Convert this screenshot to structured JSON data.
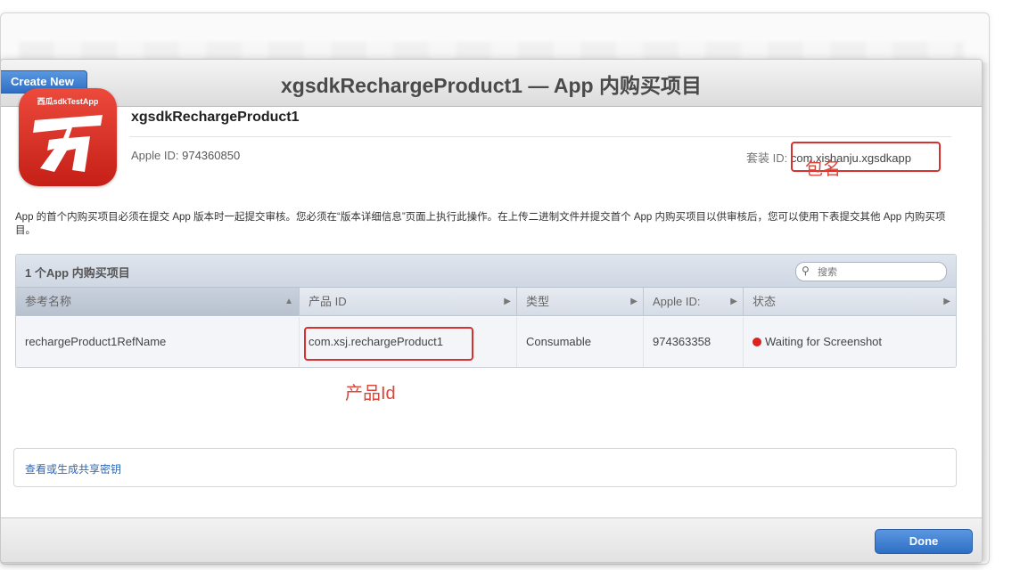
{
  "dialog": {
    "title": "xgsdkRechargeProduct1 — App 内购买项目",
    "create_new_label": "Create New",
    "done_label": "Done"
  },
  "app": {
    "icon_caption": "西瓜sdkTestApp",
    "product_name": "xgsdkRechargeProduct1",
    "apple_id_label": "Apple ID:",
    "apple_id_value": "974360850",
    "bundle_id_label": "套装 ID:",
    "bundle_id_value": "com.xishanju.xgsdkapp"
  },
  "annotations": {
    "package_name": "包名",
    "product_id": "产品Id",
    "color": "#d93030"
  },
  "notice": "App 的首个内购买项目必须在提交 App 版本时一起提交审核。您必须在“版本详细信息”页面上执行此操作。在上传二进制文件并提交首个 App 内购买项目以供审核后，您可以使用下表提交其他 App 内购买项目。",
  "table": {
    "caption": "1 个App 内购买项目",
    "search_placeholder": "搜索",
    "columns": [
      {
        "label": "参考名称"
      },
      {
        "label": "产品 ID"
      },
      {
        "label": "类型"
      },
      {
        "label": "Apple ID:"
      },
      {
        "label": "状态"
      }
    ],
    "rows": [
      {
        "reference_name": "rechargeProduct1RefName",
        "product_id": "com.xsj.rechargeProduct1",
        "type": "Consumable",
        "apple_id": "974363358",
        "status": "Waiting for Screenshot",
        "status_color": "#dd2222"
      }
    ]
  },
  "shared_secret_link": "查看或生成共享密钥",
  "colors": {
    "accent_blue": "#2f6fc4",
    "icon_red": "#d9291e"
  }
}
